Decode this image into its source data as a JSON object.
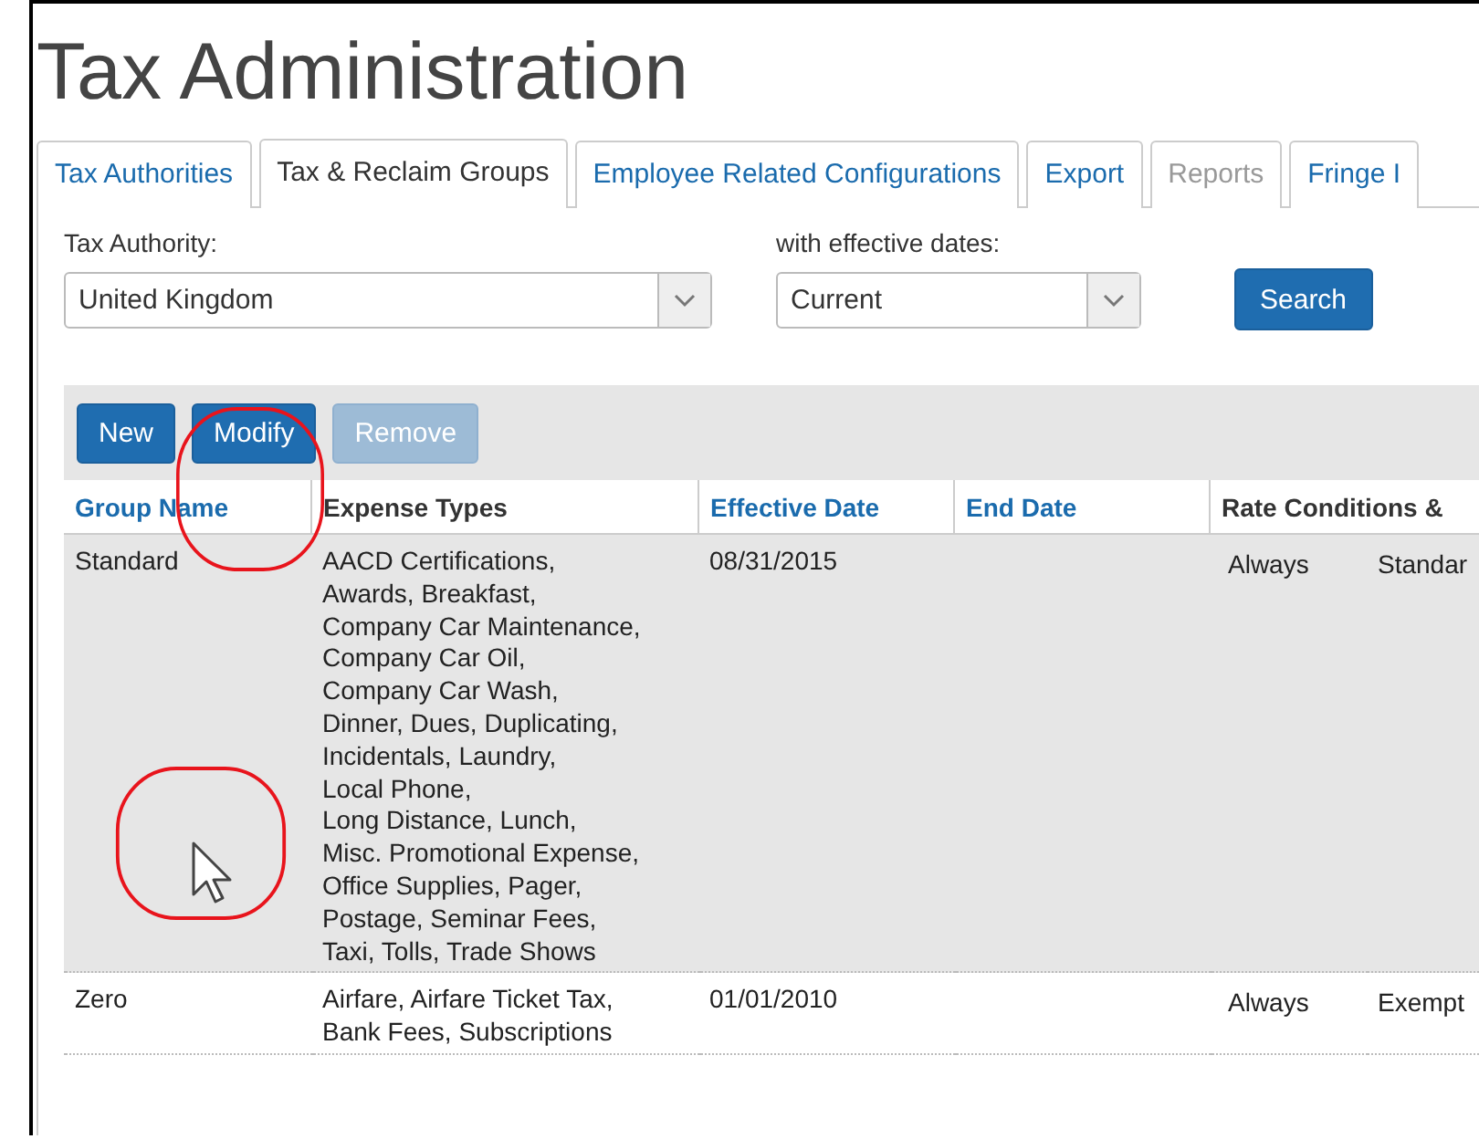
{
  "title": "Tax Administration",
  "tabs": [
    {
      "label": "Tax Authorities",
      "selected": false,
      "disabled": false
    },
    {
      "label": "Tax & Reclaim Groups",
      "selected": true,
      "disabled": false
    },
    {
      "label": "Employee Related Configurations",
      "selected": false,
      "disabled": false
    },
    {
      "label": "Export",
      "selected": false,
      "disabled": false
    },
    {
      "label": "Reports",
      "selected": false,
      "disabled": true
    },
    {
      "label": "Fringe I",
      "selected": false,
      "disabled": false
    }
  ],
  "filters": [
    {
      "label": "Tax Authority:",
      "value": "United Kingdom"
    },
    {
      "label": "with effective dates:",
      "value": "Current"
    }
  ],
  "search_button": "Search",
  "actions": [
    {
      "label": "New",
      "disabled": false
    },
    {
      "label": "Modify",
      "disabled": false
    },
    {
      "label": "Remove",
      "disabled": true
    }
  ],
  "table": {
    "columns": [
      {
        "label": "Group Name",
        "sortable": true
      },
      {
        "label": "Expense Types",
        "sortable": false
      },
      {
        "label": "Effective Date",
        "sortable": true
      },
      {
        "label": "End Date",
        "sortable": true
      },
      {
        "label": "Rate Conditions &",
        "sortable": false
      }
    ],
    "rows": [
      {
        "selected": true,
        "group": "Standard",
        "expense_types": [
          "AACD Certifications,",
          "Awards, Breakfast,",
          "Company Car Maintenance,",
          "Company Car Oil,",
          "Company Car Wash,",
          "Dinner, Dues, Duplicating,",
          "Incidentals, Laundry,",
          "Local Phone,",
          "Long Distance, Lunch,",
          "Misc. Promotional Expense,",
          "Office Supplies, Pager,",
          "Postage, Seminar Fees,",
          "Taxi, Tolls, Trade Shows"
        ],
        "effective": "08/31/2015",
        "end": "",
        "condition": "Always",
        "rate": "Standar"
      },
      {
        "selected": false,
        "group": "Zero",
        "expense_types": [
          "Airfare, Airfare Ticket Tax,",
          "Bank Fees, Subscriptions"
        ],
        "effective": "01/01/2010",
        "end": "",
        "condition": "Always",
        "rate": "Exempt"
      }
    ]
  }
}
